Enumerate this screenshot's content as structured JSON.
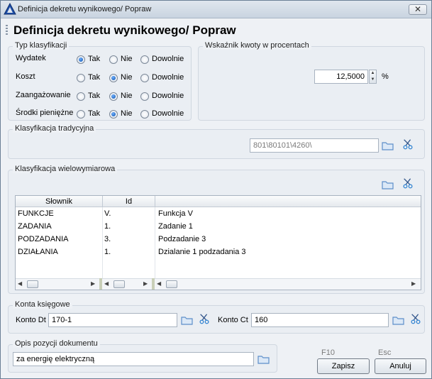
{
  "window": {
    "title": "Definicja dekretu wynikowego/ Popraw",
    "close_label": "✕"
  },
  "header": {
    "title": "Definicja dekretu wynikowego/ Popraw"
  },
  "typ_klasyfikacji": {
    "legend": "Typ klasyfikacji",
    "rows": [
      {
        "label": "Wydatek",
        "selected": "Tak"
      },
      {
        "label": "Koszt",
        "selected": "Nie"
      },
      {
        "label": "Zaangażowanie",
        "selected": "Nie"
      },
      {
        "label": "Środki pieniężne",
        "selected": "Nie"
      }
    ],
    "options": [
      "Tak",
      "Nie",
      "Dowolnie"
    ]
  },
  "wskaznik": {
    "legend": "Wskaźnik kwoty w procentach",
    "value": "12,5000",
    "unit": "%"
  },
  "klasyfikacja_tradycyjna": {
    "legend": "Klasyfikacja tradycyjna",
    "value": "801\\80101\\4260\\"
  },
  "klasyfikacja_wielowymiarowa": {
    "legend": "Klasyfikacja wielowymiarowa",
    "columns": [
      "Słownik",
      "Id",
      ""
    ],
    "rows": [
      {
        "slownik": "FUNKCJE",
        "id": "V.",
        "name": "Funkcja V"
      },
      {
        "slownik": "ZADANIA",
        "id": "1.",
        "name": "Zadanie 1"
      },
      {
        "slownik": "PODZADANIA",
        "id": "3.",
        "name": "Podzadanie 3"
      },
      {
        "slownik": "DZIAŁANIA",
        "id": "1.",
        "name": "Dzialanie 1 podzadania 3"
      }
    ]
  },
  "konta": {
    "legend": "Konta księgowe",
    "dt_label": "Konto Dt",
    "dt_value": "170-1",
    "ct_label": "Konto Ct",
    "ct_value": "160"
  },
  "opis": {
    "legend": "Opis pozycji dokumentu",
    "value": "za energię elektryczną"
  },
  "buttons": {
    "save_key": "F10",
    "save_label": "Zapisz",
    "cancel_key": "Esc",
    "cancel_label": "Anuluj"
  },
  "colors": {
    "accent": "#0b4ea8",
    "folder": "#5d8fc9"
  },
  "icons": [
    "app-logo-icon",
    "folder-icon",
    "scissors-icon",
    "close-icon"
  ]
}
